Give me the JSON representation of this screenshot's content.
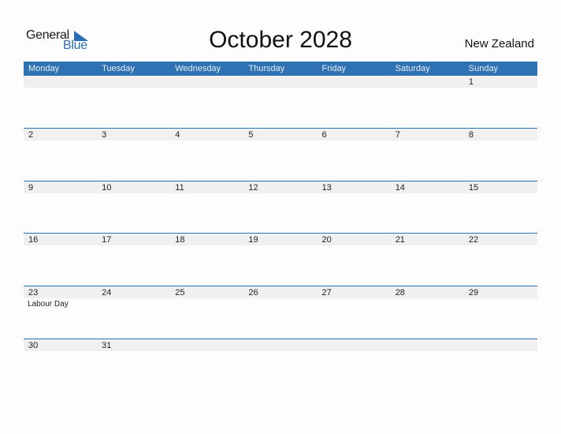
{
  "logo": {
    "general": "General",
    "blue": "Blue"
  },
  "title": "October 2028",
  "country": "New Zealand",
  "colors": {
    "accent": "#2e72b4",
    "band": "#f0f0f0"
  },
  "weekdays": [
    "Monday",
    "Tuesday",
    "Wednesday",
    "Thursday",
    "Friday",
    "Saturday",
    "Sunday"
  ],
  "weeks": [
    [
      {
        "n": ""
      },
      {
        "n": ""
      },
      {
        "n": ""
      },
      {
        "n": ""
      },
      {
        "n": ""
      },
      {
        "n": ""
      },
      {
        "n": "1"
      }
    ],
    [
      {
        "n": "2"
      },
      {
        "n": "3"
      },
      {
        "n": "4"
      },
      {
        "n": "5"
      },
      {
        "n": "6"
      },
      {
        "n": "7"
      },
      {
        "n": "8"
      }
    ],
    [
      {
        "n": "9"
      },
      {
        "n": "10"
      },
      {
        "n": "11"
      },
      {
        "n": "12"
      },
      {
        "n": "13"
      },
      {
        "n": "14"
      },
      {
        "n": "15"
      }
    ],
    [
      {
        "n": "16"
      },
      {
        "n": "17"
      },
      {
        "n": "18"
      },
      {
        "n": "19"
      },
      {
        "n": "20"
      },
      {
        "n": "21"
      },
      {
        "n": "22"
      }
    ],
    [
      {
        "n": "23",
        "e": "Labour Day"
      },
      {
        "n": "24"
      },
      {
        "n": "25"
      },
      {
        "n": "26"
      },
      {
        "n": "27"
      },
      {
        "n": "28"
      },
      {
        "n": "29"
      }
    ],
    [
      {
        "n": "30"
      },
      {
        "n": "31"
      },
      {
        "n": ""
      },
      {
        "n": ""
      },
      {
        "n": ""
      },
      {
        "n": ""
      },
      {
        "n": ""
      }
    ]
  ]
}
